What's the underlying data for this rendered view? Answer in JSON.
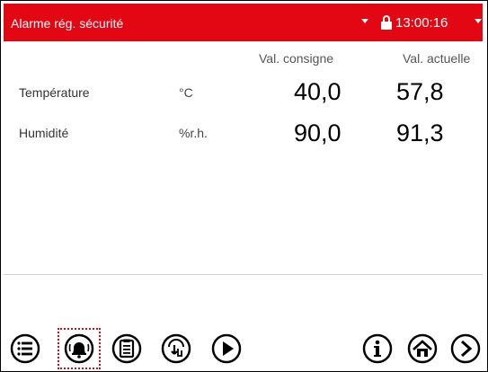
{
  "header": {
    "title": "Alarme rég. sécurité",
    "time": "13:00:16",
    "background_color": "#e30613",
    "icons": [
      "caret-down-icon",
      "lock-icon",
      "caret-down-icon"
    ]
  },
  "columns": {
    "setpoint": "Val. consigne",
    "actual": "Val. actuelle"
  },
  "rows": [
    {
      "name": "Température",
      "unit": "°C",
      "setpoint": "40,0",
      "actual": "57,8"
    },
    {
      "name": "Humidité",
      "unit": "%r.h.",
      "setpoint": "90,0",
      "actual": "91,3"
    }
  ],
  "toolbar": {
    "buttons": [
      "menu-icon",
      "alarm-bell-icon",
      "clipboard-icon",
      "touch-down-icon",
      "play-icon",
      "info-icon",
      "home-icon",
      "next-icon"
    ],
    "active": "alarm-bell-icon",
    "highlight_color": "#e30613"
  }
}
